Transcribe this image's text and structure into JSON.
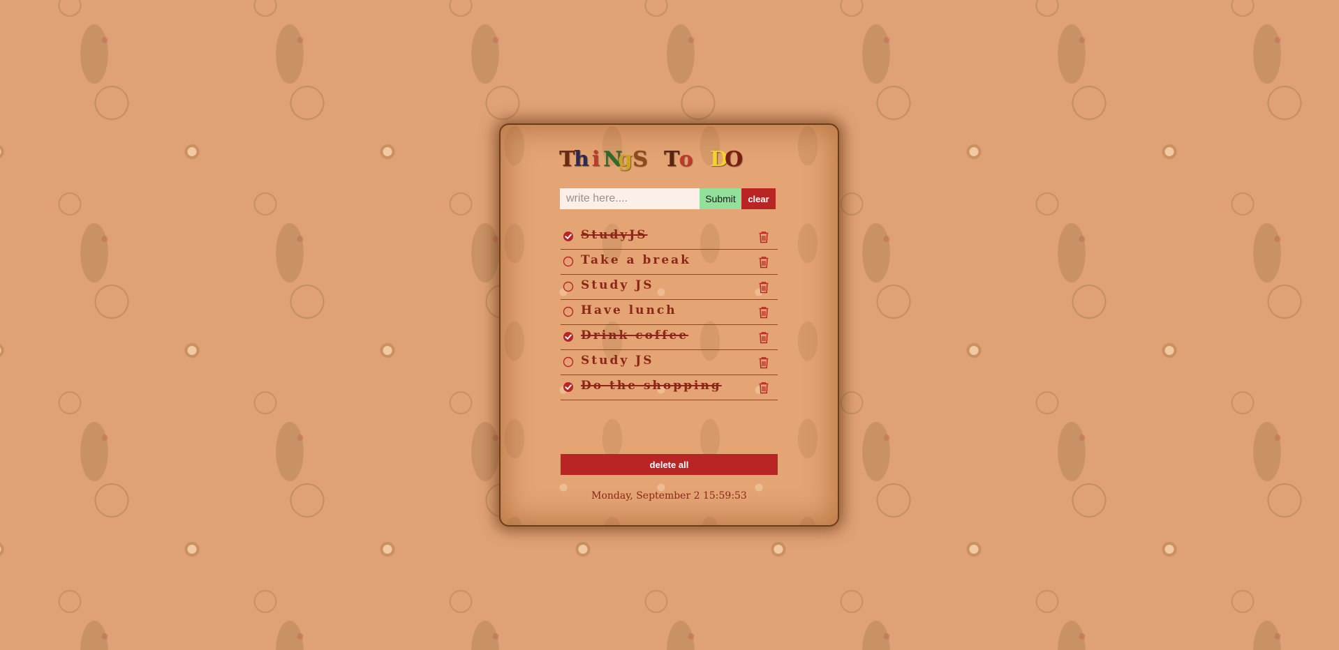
{
  "title_letters": [
    {
      "char": "T",
      "color": "#6b2b12"
    },
    {
      "char": "h",
      "color": "#2a2a55"
    },
    {
      "char": "i",
      "color": "#c0392b"
    },
    {
      "char": "N",
      "color": "#2e6b2a"
    },
    {
      "char": "g",
      "color": "#c9a227"
    },
    {
      "char": "S",
      "color": "#8b4c1a"
    },
    {
      "char": " ",
      "color": "#000000"
    },
    {
      "char": "T",
      "color": "#5a2510"
    },
    {
      "char": "o",
      "color": "#c0392b"
    },
    {
      "char": " ",
      "color": "#000000"
    },
    {
      "char": "D",
      "color": "#f2d42a"
    },
    {
      "char": "O",
      "color": "#7a1e12"
    }
  ],
  "form": {
    "input_placeholder": "write here....",
    "input_value": "",
    "submit_label": "Submit",
    "clear_label": "clear"
  },
  "todos": [
    {
      "text": "StudyJS",
      "done": true
    },
    {
      "text": "Take a break",
      "done": false
    },
    {
      "text": "Study JS",
      "done": false
    },
    {
      "text": "Have lunch",
      "done": false
    },
    {
      "text": "Drink coffee",
      "done": true
    },
    {
      "text": "Study JS",
      "done": false
    },
    {
      "text": "Do the shopping",
      "done": true
    }
  ],
  "delete_all_label": "delete all",
  "datetime": "Monday, September 2 15:59:53",
  "colors": {
    "accent_red": "#b92525",
    "text_red": "#8b2618",
    "submit_green": "#93e09a",
    "card_bg": "#e4a474",
    "page_bg": "#e0a176"
  },
  "icons": {
    "done": "check-circle-icon",
    "todo": "empty-circle-icon",
    "delete": "trash-icon"
  }
}
